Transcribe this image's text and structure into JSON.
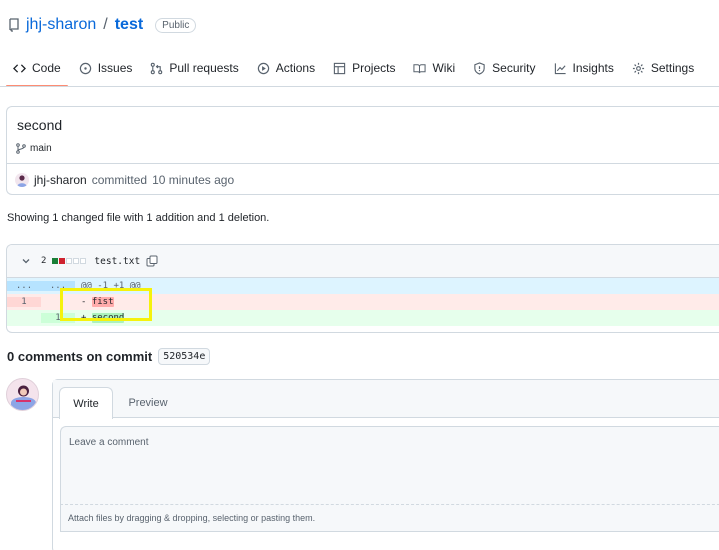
{
  "repo": {
    "owner": "jhj-sharon",
    "separator": "/",
    "name": "test",
    "visibility": "Public"
  },
  "tabs": [
    {
      "label": "Code",
      "icon": "code-icon"
    },
    {
      "label": "Issues",
      "icon": "issue-icon"
    },
    {
      "label": "Pull requests",
      "icon": "pull-request-icon"
    },
    {
      "label": "Actions",
      "icon": "play-icon"
    },
    {
      "label": "Projects",
      "icon": "table-icon"
    },
    {
      "label": "Wiki",
      "icon": "book-icon"
    },
    {
      "label": "Security",
      "icon": "shield-icon"
    },
    {
      "label": "Insights",
      "icon": "graph-icon"
    },
    {
      "label": "Settings",
      "icon": "gear-icon"
    }
  ],
  "commit": {
    "title": "second",
    "branch": "main",
    "author": "jhj-sharon",
    "action": "committed",
    "time": "10 minutes ago"
  },
  "summary": "Showing 1 changed file with 1 addition and 1 deletion.",
  "diff": {
    "count": "2",
    "file": "test.txt",
    "hunk": {
      "left": "...",
      "right": "...",
      "text": "@@ -1 +1 @@"
    },
    "deleted": {
      "line": "1",
      "sign": "-",
      "text": "fist"
    },
    "added": {
      "line": "1",
      "sign": "+",
      "text": "second"
    }
  },
  "comments": {
    "title": "0 comments on commit",
    "sha": "520534e",
    "tab_write": "Write",
    "tab_preview": "Preview",
    "placeholder": "Leave a comment",
    "attach": "Attach files by dragging & dropping, selecting or pasting them."
  },
  "colors": {
    "accent": "#0969da",
    "active_tab": "#fd8c73",
    "highlight_box": "#f5f20c"
  }
}
